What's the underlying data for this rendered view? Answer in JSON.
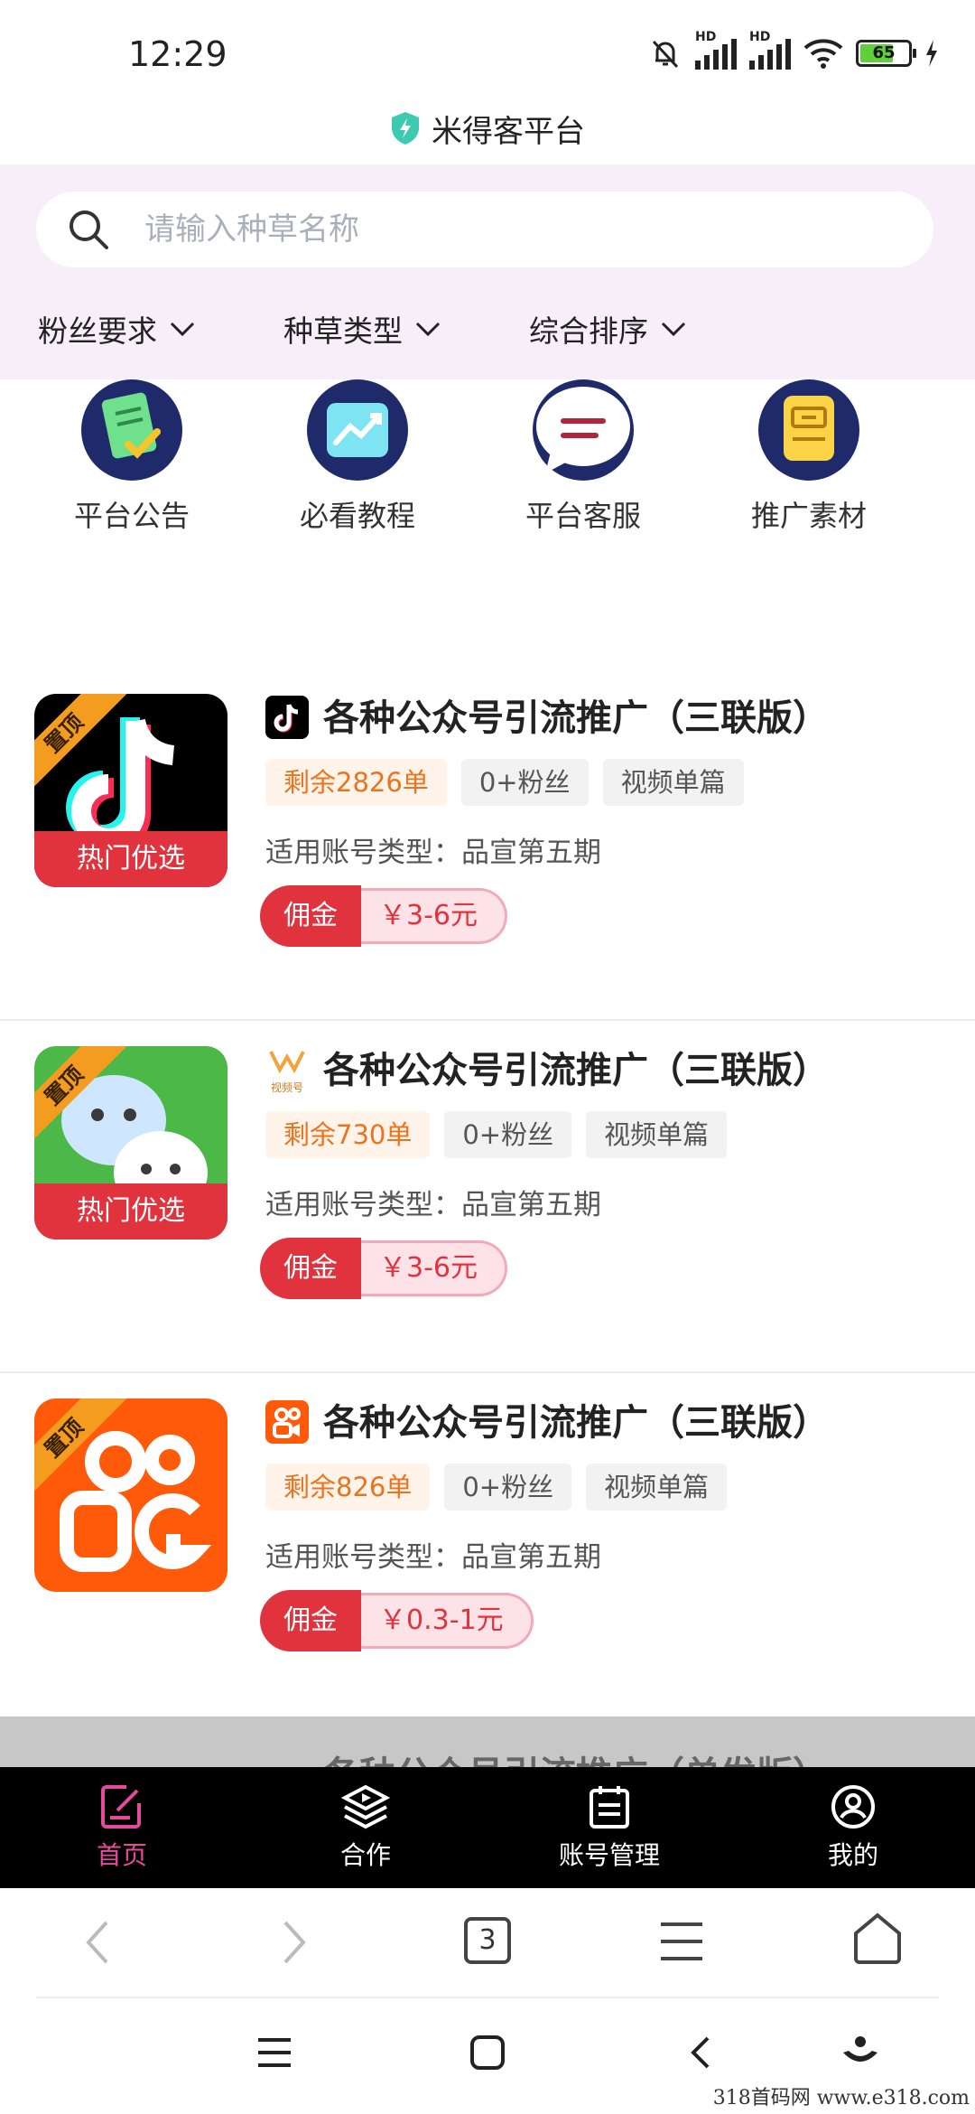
{
  "status_bar": {
    "time": "12:29",
    "battery": "65",
    "hd1": "HD",
    "hd2": "HD"
  },
  "app": {
    "title": "米得客平台"
  },
  "search": {
    "placeholder": "请输入种草名称"
  },
  "filters": [
    {
      "label": "粉丝要求"
    },
    {
      "label": "种草类型"
    },
    {
      "label": "综合排序"
    }
  ],
  "entries": [
    {
      "label": "平台公告",
      "icon": "notice-icon"
    },
    {
      "label": "必看教程",
      "icon": "trend-chart-icon"
    },
    {
      "label": "平台客服",
      "icon": "chat-bubble-icon"
    },
    {
      "label": "推广素材",
      "icon": "inbox-icon"
    }
  ],
  "cards": [
    {
      "platform": "douyin",
      "pin": "置顶",
      "hot": "热门优选",
      "title": "各种公众号引流推广（三联版）",
      "remain": "剩余2826单",
      "fans": "0+粉丝",
      "type": "视频单篇",
      "account_type": "适用账号类型：品宣第五期",
      "commission_label": "佣金",
      "price": "￥3-6元"
    },
    {
      "platform": "shipinhao",
      "platform_label": "视频号",
      "pin": "置顶",
      "hot": "热门优选",
      "title": "各种公众号引流推广（三联版）",
      "remain": "剩余730单",
      "fans": "0+粉丝",
      "type": "视频单篇",
      "account_type": "适用账号类型：品宣第五期",
      "commission_label": "佣金",
      "price": "￥3-6元"
    },
    {
      "platform": "kuaishou",
      "pin": "置顶",
      "title": "各种公众号引流推广（三联版）",
      "remain": "剩余826单",
      "fans": "0+粉丝",
      "type": "视频单篇",
      "account_type": "适用账号类型：品宣第五期",
      "commission_label": "佣金",
      "price": "￥0.3-1元"
    }
  ],
  "next_card_peek": {
    "title": "各种公众号引流推广（单发版）"
  },
  "tabbar": [
    {
      "label": "首页",
      "icon": "edit-note-icon",
      "active": true
    },
    {
      "label": "合作",
      "icon": "layers-play-icon",
      "active": false
    },
    {
      "label": "账号管理",
      "icon": "clipboard-list-icon",
      "active": false
    },
    {
      "label": "我的",
      "icon": "user-circle-icon",
      "active": false
    }
  ],
  "browser": {
    "tab_count": "3"
  },
  "watermark": "318首码网  www.e318.com",
  "colors": {
    "accent_red": "#e0333e",
    "active_tab": "#e64a9b",
    "header_bg": "#f7eefa",
    "remain_orange": "#e8741e"
  }
}
